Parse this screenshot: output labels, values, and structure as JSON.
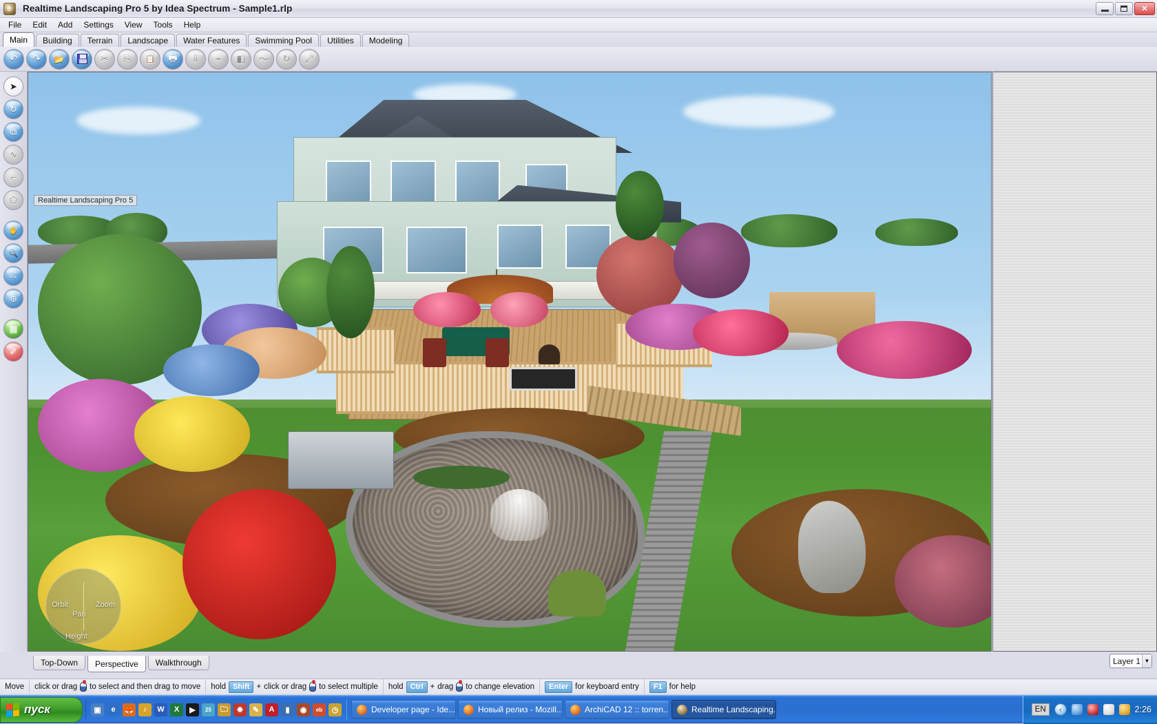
{
  "window": {
    "title": "Realtime Landscaping Pro 5 by Idea Spectrum - Sample1.rlp",
    "app_icon": "app-globe-icon",
    "minimize_label": "",
    "maximize_label": "",
    "close_label": "✕"
  },
  "menu": {
    "items": [
      "File",
      "Edit",
      "Add",
      "Settings",
      "View",
      "Tools",
      "Help"
    ]
  },
  "ribbon": {
    "tabs": [
      {
        "label": "Main",
        "active": true
      },
      {
        "label": "Building",
        "active": false
      },
      {
        "label": "Terrain",
        "active": false
      },
      {
        "label": "Landscape",
        "active": false
      },
      {
        "label": "Water Features",
        "active": false
      },
      {
        "label": "Swimming Pool",
        "active": false
      },
      {
        "label": "Utilities",
        "active": false
      },
      {
        "label": "Modeling",
        "active": false
      }
    ]
  },
  "toolbar": {
    "buttons": [
      {
        "name": "undo-icon",
        "glyph": "↶",
        "style": "blue",
        "enabled": true
      },
      {
        "name": "redo-icon",
        "glyph": "↷",
        "style": "blue",
        "enabled": true
      },
      {
        "name": "open-folder-icon",
        "glyph": "📂",
        "style": "blue",
        "enabled": true
      },
      {
        "name": "save-icon",
        "glyph": "",
        "style": "save",
        "enabled": true
      },
      {
        "name": "cut-icon",
        "glyph": "✂",
        "style": "grey",
        "enabled": false
      },
      {
        "name": "copy-icon",
        "glyph": "⎘",
        "style": "grey",
        "enabled": false
      },
      {
        "name": "paste-icon",
        "glyph": "📋",
        "style": "grey",
        "enabled": false
      },
      {
        "name": "print-icon",
        "glyph": "🖶",
        "style": "blue",
        "enabled": true
      },
      {
        "name": "place-object-icon",
        "glyph": "⇩",
        "style": "grey",
        "enabled": false
      },
      {
        "name": "flatten-icon",
        "glyph": "⌁",
        "style": "grey",
        "enabled": false
      },
      {
        "name": "mirror-icon",
        "glyph": "◧",
        "style": "grey",
        "enabled": false
      },
      {
        "name": "smooth-icon",
        "glyph": "〜",
        "style": "grey",
        "enabled": false
      },
      {
        "name": "rotate-icon",
        "glyph": "↻",
        "style": "grey",
        "enabled": false
      },
      {
        "name": "scale-icon",
        "glyph": "⤢",
        "style": "grey",
        "enabled": false
      }
    ]
  },
  "left_rail": {
    "buttons": [
      {
        "name": "select-arrow-icon",
        "glyph": "➤",
        "style": "white"
      },
      {
        "name": "rotate-object-icon",
        "glyph": "↻",
        "style": "blue"
      },
      {
        "name": "resize-object-icon",
        "glyph": "⧉",
        "style": "blue"
      },
      {
        "name": "draw-curve-icon",
        "glyph": "∿",
        "style": "grey"
      },
      {
        "name": "draw-line-icon",
        "glyph": "⌐",
        "style": "grey"
      },
      {
        "name": "draw-region-icon",
        "glyph": "⬠",
        "style": "grey"
      },
      {
        "name": "pan-hand-icon",
        "glyph": "✋",
        "style": "blue"
      },
      {
        "name": "zoom-magnifier-icon",
        "glyph": "🔍",
        "style": "blue"
      },
      {
        "name": "zoom-window-icon",
        "glyph": "⛶",
        "style": "blue"
      },
      {
        "name": "orbit-globe-icon",
        "glyph": "🜨",
        "style": "blue"
      },
      {
        "name": "terrain-grid-icon",
        "glyph": "▦",
        "style": "green"
      },
      {
        "name": "eyedropper-icon",
        "glyph": "✐",
        "style": "red"
      }
    ]
  },
  "viewport": {
    "overlay_label": "Realtime Landscaping Pro 5",
    "nav_widget": {
      "orbit": "Orbit",
      "zoom": "Zoom",
      "pan": "Pan",
      "height": "Height"
    }
  },
  "view_tabs": [
    {
      "label": "Top-Down",
      "active": false
    },
    {
      "label": "Perspective",
      "active": true
    },
    {
      "label": "Walkthrough",
      "active": false
    }
  ],
  "layer_selector": {
    "value": "Layer 1",
    "arrow": "▼"
  },
  "status_bar": {
    "mode": "Move",
    "hint1_a": "click or drag",
    "hint1_b": "to select and then drag to move",
    "hint2_a": "hold",
    "hint2_key": "Shift",
    "hint2_plus": "+",
    "hint2_b": "click or drag",
    "hint2_c": "to select multiple",
    "hint3_a": "hold",
    "hint3_key": "Ctrl",
    "hint3_plus": "+",
    "hint3_b": "drag",
    "hint3_c": "to change elevation",
    "hint4_key": "Enter",
    "hint4_b": "for keyboard entry",
    "hint5_key": "F1",
    "hint5_b": "for help"
  },
  "taskbar": {
    "start_label": "пуск",
    "quick_launch": [
      {
        "name": "show-desktop-icon",
        "glyph": "▣",
        "color": "#4a7fc1"
      },
      {
        "name": "internet-explorer-icon",
        "glyph": "e",
        "color": "#2c6fc4"
      },
      {
        "name": "firefox-icon",
        "glyph": "🦊",
        "color": "#e06a1a"
      },
      {
        "name": "media-player-icon",
        "glyph": "♪",
        "color": "#d8a32a"
      },
      {
        "name": "word-icon",
        "glyph": "W",
        "color": "#2a5bb8"
      },
      {
        "name": "excel-icon",
        "glyph": "X",
        "color": "#1e7a3c"
      },
      {
        "name": "winamp-icon",
        "glyph": "▶",
        "color": "#1a1a1a"
      },
      {
        "name": "calendar-icon",
        "glyph": "25",
        "color": "#4aa6c8"
      },
      {
        "name": "explorer-folder-icon",
        "glyph": "🗀",
        "color": "#c79a33"
      },
      {
        "name": "maple-icon",
        "glyph": "✹",
        "color": "#c0392b"
      },
      {
        "name": "notes-icon",
        "glyph": "✎",
        "color": "#d9b24a"
      },
      {
        "name": "acrobat-icon",
        "glyph": "A",
        "color": "#c0202a"
      },
      {
        "name": "usb-drive-icon",
        "glyph": "▮",
        "color": "#3b6fb0"
      },
      {
        "name": "nero-icon",
        "glyph": "◉",
        "color": "#a84a2a"
      },
      {
        "name": "ebay-icon",
        "glyph": "eb",
        "color": "#d24c2c"
      },
      {
        "name": "clock-tool-icon",
        "glyph": "◷",
        "color": "#caa433"
      }
    ],
    "tasks": [
      {
        "label": "Developer page - Ide...",
        "icon": "firefox-icon",
        "active": false
      },
      {
        "label": "Новый релиз - Mozill...",
        "icon": "firefox-icon",
        "active": false
      },
      {
        "label": "ArchiCAD 12 :: torren...",
        "icon": "firefox-icon",
        "active": false
      },
      {
        "label": "Realtime Landscaping...",
        "icon": "app-globe-icon",
        "active": true
      }
    ],
    "tray": {
      "language": "EN",
      "chevron": "‹",
      "icons": [
        {
          "name": "network-icon",
          "color": "#5b9bd5"
        },
        {
          "name": "antivirus-icon",
          "color": "#c42b2b"
        },
        {
          "name": "volume-icon",
          "color": "#d8d8d8"
        },
        {
          "name": "update-icon",
          "color": "#e0a32a"
        }
      ],
      "clock": "2:26"
    }
  }
}
